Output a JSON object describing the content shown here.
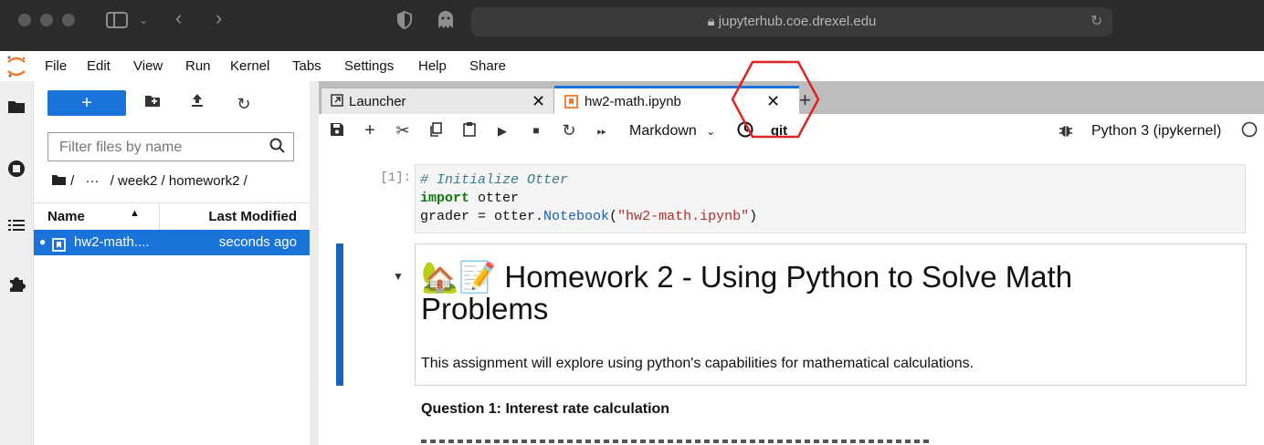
{
  "browser": {
    "url": "jupyterhub.coe.drexel.edu",
    "icons": [
      "sidebar-toggle-icon",
      "back-icon",
      "forward-icon",
      "shield-icon",
      "ghost-icon",
      "lock-icon",
      "reload-icon"
    ]
  },
  "menu": {
    "items": [
      "File",
      "Edit",
      "View",
      "Run",
      "Kernel",
      "Tabs",
      "Settings",
      "Help",
      "Share"
    ]
  },
  "filebrowser": {
    "new_label": "+",
    "filter_placeholder": "Filter files by name",
    "breadcrumb": {
      "root": "/",
      "ellipsis": "···",
      "path": "/ week2 / homework2 /"
    },
    "columns": {
      "name": "Name",
      "modified": "Last Modified"
    },
    "files": [
      {
        "name": "hw2-math....",
        "modified": "seconds ago"
      }
    ]
  },
  "tabs": [
    {
      "label": "Launcher"
    },
    {
      "label": "hw2-math.ipynb"
    }
  ],
  "toolbar": {
    "cell_type": "Markdown",
    "git_label": "git",
    "kernel": "Python 3 (ipykernel)"
  },
  "notebook": {
    "code_prompt": "[1]:",
    "code_lines": {
      "comment": "# Initialize Otter",
      "import_kw": "import",
      "import_mod": " otter",
      "grader_lhs": "grader = otter.",
      "grader_attr": "Notebook",
      "grader_open": "(",
      "grader_str": "\"hw2-math.ipynb\"",
      "grader_close": ")"
    },
    "heading_emoji": "🏡📝",
    "heading": "Homework 2 - Using Python to Solve Math Problems",
    "intro": "This assignment will explore using python's capabilities for mathematical calculations.",
    "question": "Question 1: Interest rate calculation"
  },
  "colors": {
    "accent": "#1a73d9",
    "annotation": "#e02424"
  }
}
